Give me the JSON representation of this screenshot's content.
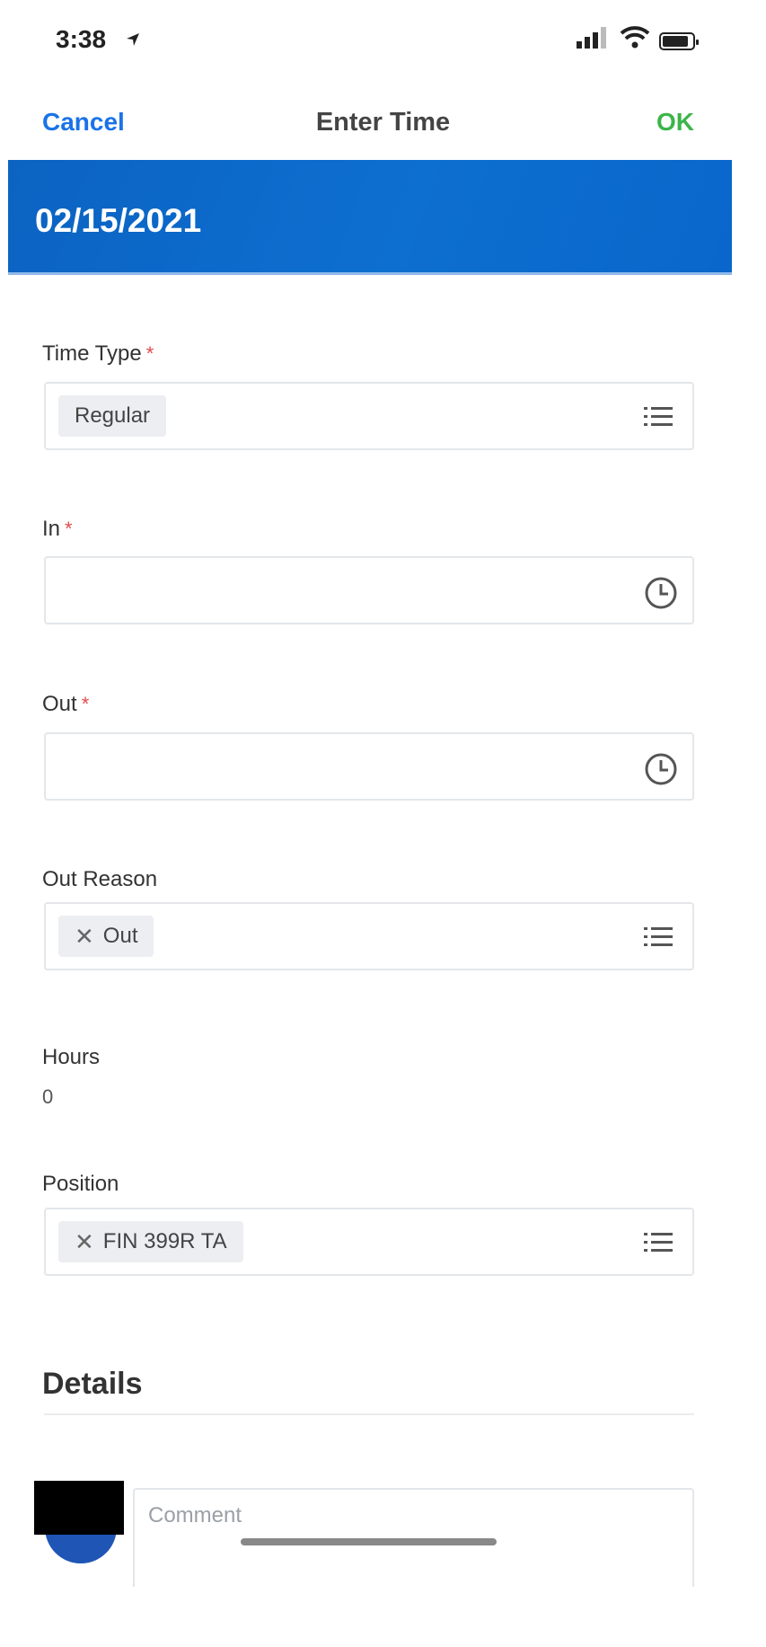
{
  "status_bar": {
    "time": "3:38"
  },
  "nav": {
    "cancel": "Cancel",
    "title": "Enter Time",
    "ok": "OK"
  },
  "banner": {
    "date": "02/15/2021"
  },
  "form": {
    "time_type": {
      "label": "Time Type",
      "required_mark": "*",
      "value": "Regular"
    },
    "in": {
      "label": "In",
      "required_mark": "*",
      "value": ""
    },
    "out": {
      "label": "Out",
      "required_mark": "*",
      "value": ""
    },
    "out_reason": {
      "label": "Out Reason",
      "value": "Out"
    },
    "hours": {
      "label": "Hours",
      "value": "0"
    },
    "position": {
      "label": "Position",
      "value": "FIN 399R TA"
    }
  },
  "details": {
    "title": "Details",
    "comment_placeholder": "Comment"
  },
  "colors": {
    "accent_blue": "#1a73e8",
    "ok_green": "#3cb54a",
    "banner_blue": "#0c63c2",
    "required_red": "#e24b4b"
  },
  "icons": [
    "location-arrow-icon",
    "signal-icon",
    "wifi-icon",
    "battery-icon",
    "list-icon",
    "clock-icon",
    "close-icon"
  ]
}
